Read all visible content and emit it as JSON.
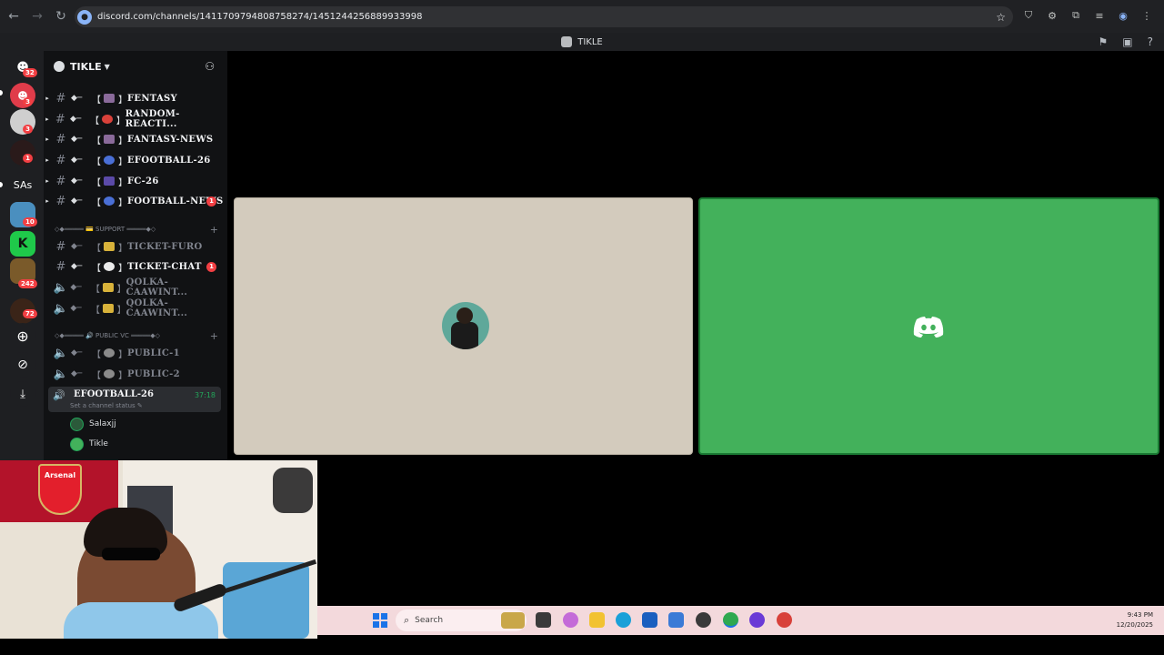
{
  "browser": {
    "url": "discord.com/channels/1411709794808758274/1451244256889933998",
    "back": "←",
    "forward": "→",
    "reload": "↻",
    "star": "☆"
  },
  "titlebar": {
    "title": "TIKLE"
  },
  "server": {
    "name": "TIKLE"
  },
  "channels": [
    {
      "name": "FENTASY",
      "unread": ""
    },
    {
      "name": "RANDOM-REACTI...",
      "unread": ""
    },
    {
      "name": "FANTASY-NEWS",
      "unread": ""
    },
    {
      "name": "EFOOTBALL-26",
      "unread": ""
    },
    {
      "name": "FC-26",
      "unread": ""
    },
    {
      "name": "FOOTBALL-NEWS",
      "unread": "1"
    }
  ],
  "support_category": {
    "label": "◇◆═════ 💳 SUPPORT ═════◆◇"
  },
  "support_channels": [
    {
      "name": "TICKET-FURO",
      "unread": ""
    },
    {
      "name": "TICKET-CHAT",
      "unread": "1"
    },
    {
      "name": "QOLKA-CAAWINT...",
      "unread": ""
    },
    {
      "name": "QOLKA-CAAWINT...",
      "unread": ""
    }
  ],
  "public_category": {
    "label": "◇◆═════ 🔊 PUBLIC VC ═════◆◇"
  },
  "public_channels": [
    {
      "name": "PUBLIC-1"
    },
    {
      "name": "PUBLIC-2"
    }
  ],
  "active_voice": {
    "name": "EFOOTBALL-26",
    "timer": "37:18",
    "status": "Set a channel status ✎"
  },
  "voice_users": [
    {
      "name": "Salaxjj"
    },
    {
      "name": "Tikle"
    }
  ],
  "server_badges": [
    "32",
    "3",
    "3",
    "1",
    "10",
    "242",
    "72"
  ],
  "server_text": {
    "sas": "SAs"
  },
  "webcam": {
    "flag_text": "Arsenal"
  },
  "taskbar": {
    "search_placeholder": "Search",
    "time": "9:43 PM",
    "date": "12/20/2025"
  },
  "colors": {
    "discord_green": "#43b15b",
    "speaking_green": "#23a55a",
    "mention_red": "#f23f43"
  }
}
